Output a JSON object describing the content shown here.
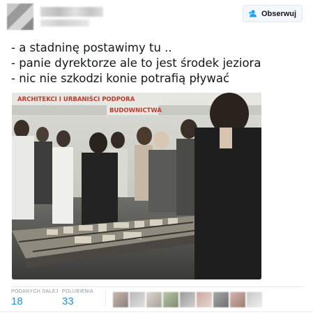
{
  "header": {
    "follow_label": "Obserwuj",
    "follow_icon": "add-user-icon"
  },
  "tweet": {
    "lines": [
      "- a stadninę postawimy tu ..",
      "- panie dyrektorze ale to jest środek jeziora",
      "- nic nie szkodzi konie potrafią pływać"
    ]
  },
  "media": {
    "banner_line1": "ARCHITEKCI I URBANIŚCI PODPORA",
    "banner_line2": "BUDOWNICTWA"
  },
  "stats": {
    "retweets_label": "PODANYCH DALEJ",
    "retweets_value": "18",
    "likes_label": "POLUBIENIA",
    "likes_value": "33"
  },
  "colors": {
    "accent": "#1b95e0",
    "muted": "#8899a6",
    "border": "#e6ecf0"
  }
}
